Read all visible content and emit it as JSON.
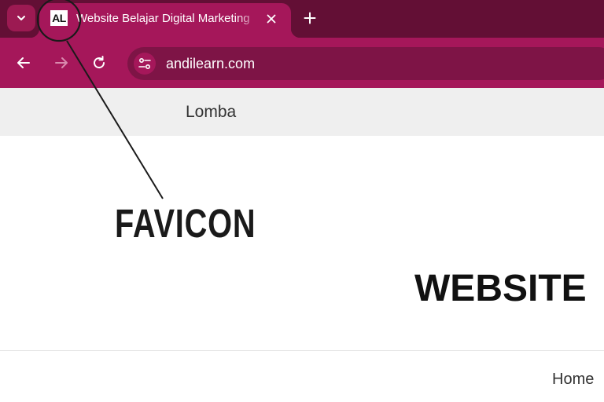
{
  "browser": {
    "tab": {
      "favicon_text": "AL",
      "title": "Website Belajar Digital Marketing",
      "close_label": "✕"
    },
    "new_tab_label": "+",
    "address_bar": {
      "url": "andilearn.com"
    },
    "colors": {
      "tabstrip": "#630f35",
      "active_tab": "#a5175a",
      "omnibox": "#7e1446"
    }
  },
  "page": {
    "nav_items": [
      "Lomba"
    ],
    "site_title": "WEBSITE",
    "menu_items": [
      "Home"
    ]
  },
  "annotation": {
    "label": "FAVICON"
  },
  "icons": {
    "tab_search": "chevron-down-icon",
    "back": "arrow-left-icon",
    "forward": "arrow-right-icon",
    "reload": "reload-icon",
    "site_info": "tune-icon"
  }
}
